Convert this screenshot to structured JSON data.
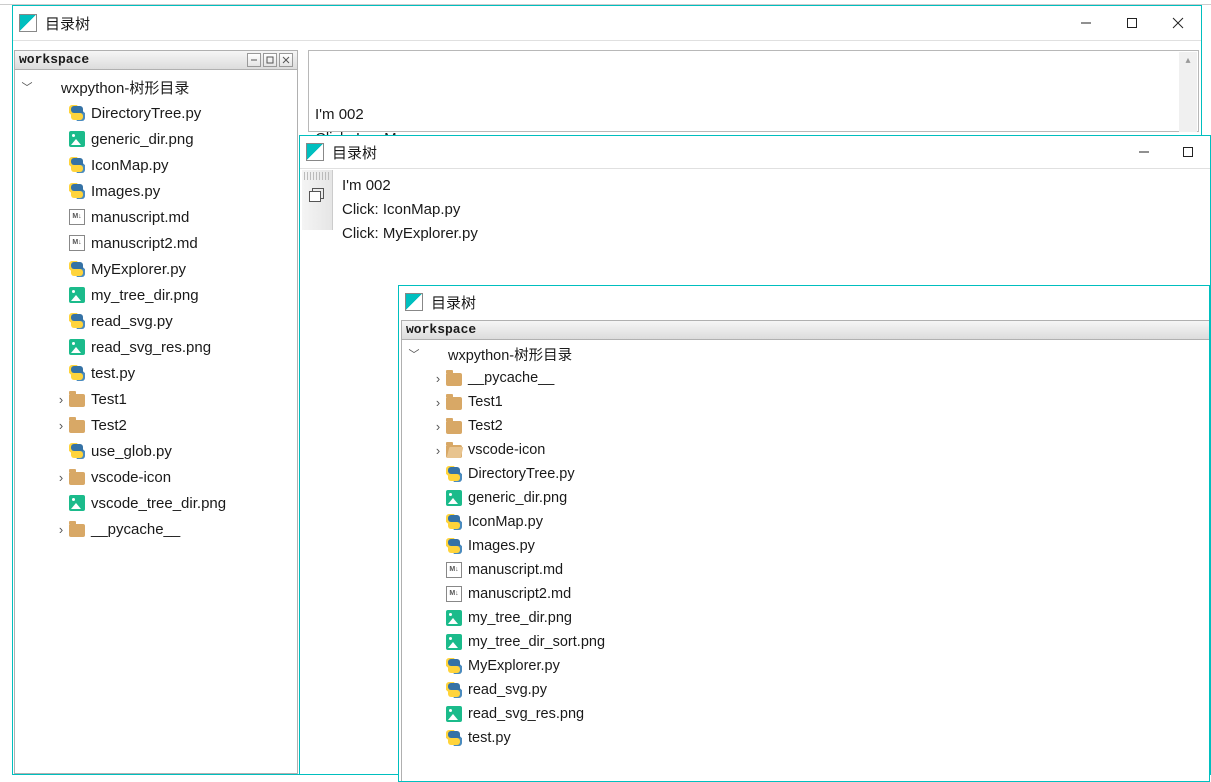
{
  "app_title": "目录树",
  "workspace_label": "workspace",
  "md_badge": "M↓",
  "win1": {
    "log_lines": [
      "I'm 002",
      "Click: IconMap.py",
      "Click: MyExplorer.py"
    ],
    "tree": {
      "root": {
        "label": "wxpython-树形目录",
        "expanded": true
      },
      "items": [
        {
          "icon": "py",
          "label": "DirectoryTree.py"
        },
        {
          "icon": "img",
          "label": "generic_dir.png"
        },
        {
          "icon": "py",
          "label": "IconMap.py"
        },
        {
          "icon": "py",
          "label": "Images.py"
        },
        {
          "icon": "md",
          "label": "manuscript.md"
        },
        {
          "icon": "md",
          "label": "manuscript2.md"
        },
        {
          "icon": "py",
          "label": "MyExplorer.py"
        },
        {
          "icon": "img",
          "label": "my_tree_dir.png"
        },
        {
          "icon": "py",
          "label": "read_svg.py"
        },
        {
          "icon": "img",
          "label": "read_svg_res.png"
        },
        {
          "icon": "py",
          "label": "test.py"
        },
        {
          "icon": "folder",
          "label": "Test1",
          "expandable": true
        },
        {
          "icon": "folder",
          "label": "Test2",
          "expandable": true
        },
        {
          "icon": "py",
          "label": "use_glob.py"
        },
        {
          "icon": "folder",
          "label": "vscode-icon",
          "expandable": true
        },
        {
          "icon": "img",
          "label": "vscode_tree_dir.png"
        },
        {
          "icon": "folder",
          "label": "__pycache__",
          "expandable": true
        }
      ]
    }
  },
  "win2": {
    "title": "目录树",
    "log_lines": [
      "I'm 002",
      "Click: IconMap.py",
      "Click: MyExplorer.py"
    ]
  },
  "win3": {
    "title": "目录树",
    "workspace_label": "workspace",
    "tree": {
      "root": {
        "label": "wxpython-树形目录",
        "expanded": true
      },
      "items": [
        {
          "icon": "folder",
          "label": "__pycache__",
          "expandable": true
        },
        {
          "icon": "folder",
          "label": "Test1",
          "expandable": true
        },
        {
          "icon": "folder",
          "label": "Test2",
          "expandable": true
        },
        {
          "icon": "folder-open",
          "label": "vscode-icon",
          "expandable": true
        },
        {
          "icon": "py",
          "label": "DirectoryTree.py"
        },
        {
          "icon": "img",
          "label": "generic_dir.png"
        },
        {
          "icon": "py",
          "label": "IconMap.py"
        },
        {
          "icon": "py",
          "label": "Images.py"
        },
        {
          "icon": "md",
          "label": "manuscript.md"
        },
        {
          "icon": "md",
          "label": "manuscript2.md"
        },
        {
          "icon": "img",
          "label": "my_tree_dir.png"
        },
        {
          "icon": "img",
          "label": "my_tree_dir_sort.png"
        },
        {
          "icon": "py",
          "label": "MyExplorer.py"
        },
        {
          "icon": "py",
          "label": "read_svg.py"
        },
        {
          "icon": "img",
          "label": "read_svg_res.png"
        },
        {
          "icon": "py",
          "label": "test.py"
        }
      ]
    }
  }
}
